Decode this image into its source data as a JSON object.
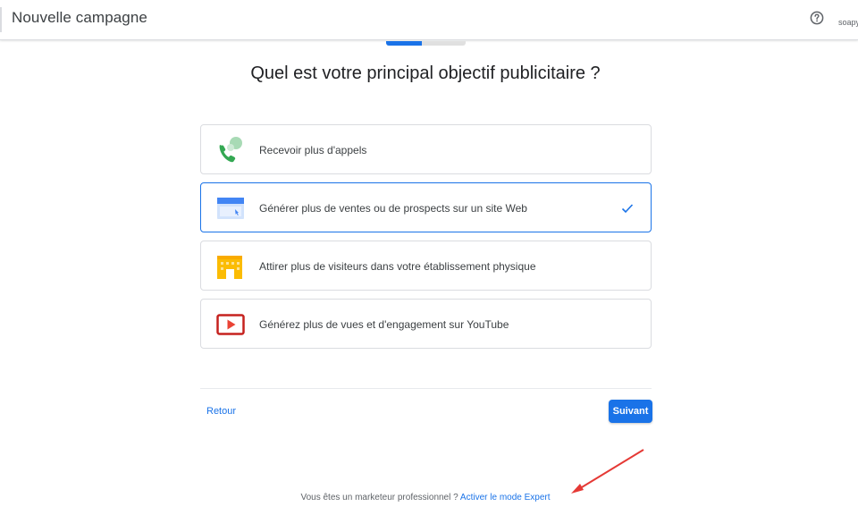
{
  "header": {
    "title": "Nouvelle campagne",
    "account_text": "soapy"
  },
  "progress": {
    "fraction": 0.45,
    "color": "#1a73e8"
  },
  "main": {
    "question": "Quel est votre principal objectif publicitaire ?",
    "options": [
      {
        "label": "Recevoir plus d'appels",
        "icon": "phone-icon",
        "selected": false
      },
      {
        "label": "Générer plus de ventes ou de prospects sur un site Web",
        "icon": "website-icon",
        "selected": true
      },
      {
        "label": "Attirer plus de visiteurs dans votre établissement physique",
        "icon": "store-icon",
        "selected": false
      },
      {
        "label": "Générez plus de vues et d'engagement sur YouTube",
        "icon": "youtube-play-icon",
        "selected": false
      }
    ]
  },
  "actions": {
    "back_label": "Retour",
    "next_label": "Suivant"
  },
  "footer": {
    "prompt": "Vous êtes un marketeur professionnel ? ",
    "link": "Activer le mode Expert"
  },
  "colors": {
    "accent": "#1a73e8",
    "annotation_arrow": "#e53935"
  }
}
